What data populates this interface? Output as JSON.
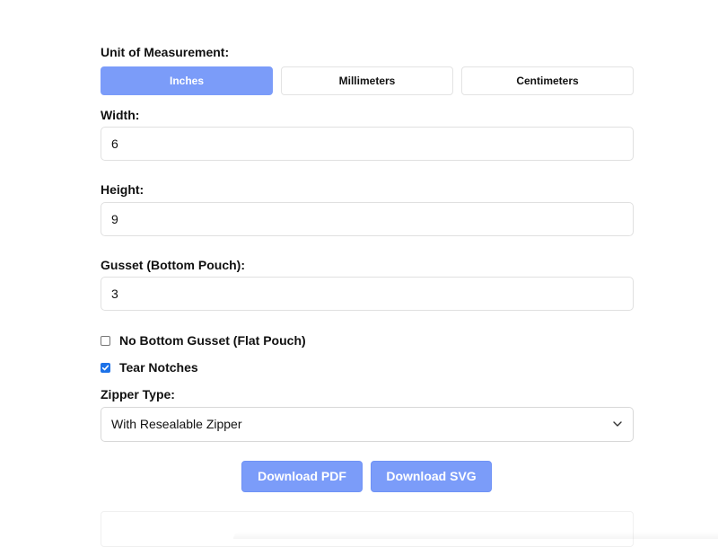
{
  "unit": {
    "label": "Unit of Measurement:",
    "options": [
      "Inches",
      "Millimeters",
      "Centimeters"
    ],
    "selected": "Inches"
  },
  "width": {
    "label": "Width:",
    "value": "6"
  },
  "height": {
    "label": "Height:",
    "value": "9"
  },
  "gusset": {
    "label": "Gusset (Bottom Pouch):",
    "value": "3"
  },
  "no_gusset": {
    "label": "No Bottom Gusset (Flat Pouch)",
    "checked": false
  },
  "tear_notches": {
    "label": "Tear Notches",
    "checked": true
  },
  "zipper": {
    "label": "Zipper Type:",
    "selected": "With Resealable Zipper"
  },
  "actions": {
    "download_pdf": "Download PDF",
    "download_svg": "Download SVG"
  },
  "colors": {
    "accent": "#7b9cf9",
    "checkbox": "#1d72e8"
  },
  "icons": {
    "select_chevron": "chevron-down-icon",
    "check": "checkmark-icon"
  }
}
